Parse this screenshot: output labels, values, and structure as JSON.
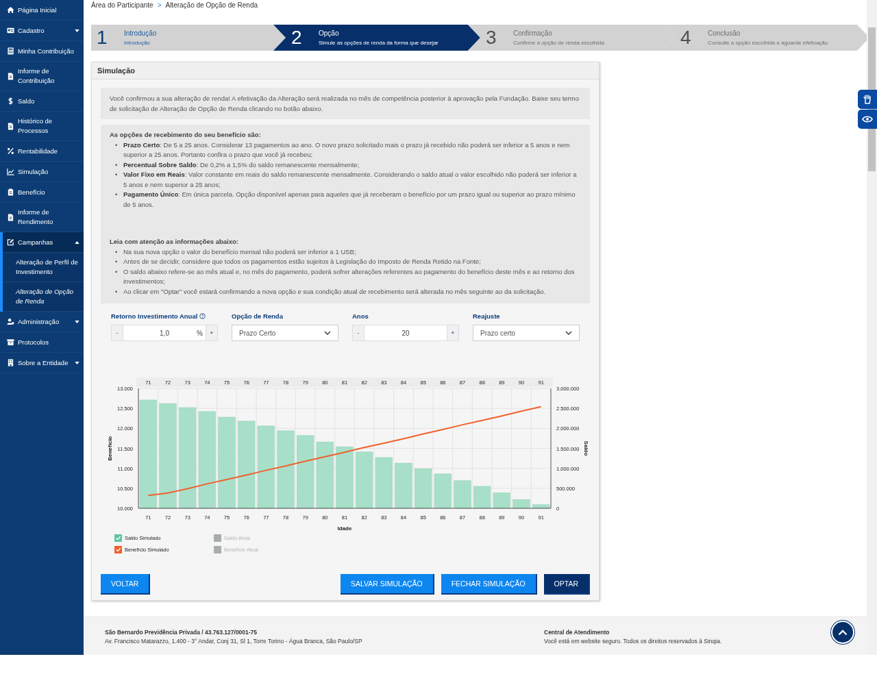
{
  "sidebar": {
    "items": [
      {
        "label": "Página Inicial"
      },
      {
        "label": "Cadastro",
        "expanded": false
      },
      {
        "label": "Minha Contribuição"
      },
      {
        "label": "Informe de Contribuição"
      },
      {
        "label": "Saldo"
      },
      {
        "label": "Histórico de Processos"
      },
      {
        "label": "Rentabilidade"
      },
      {
        "label": "Simulação"
      },
      {
        "label": "Benefício"
      },
      {
        "label": "Informe de Rendimento"
      },
      {
        "label": "Campanhas",
        "expanded": true,
        "children": [
          {
            "label": "Alteração de Perfil de Investimento",
            "selected": false
          },
          {
            "label": "Alteração de Opção de Renda",
            "selected": true
          }
        ]
      },
      {
        "label": "Administração",
        "expanded": false
      },
      {
        "label": "Protocolos"
      },
      {
        "label": "Sobre a Entidade",
        "expanded": false
      }
    ]
  },
  "breadcrumb": [
    "Área do Participante",
    "Alteração de Opção de Renda"
  ],
  "breadcrumb_separator": ">",
  "steps": [
    {
      "number": "1",
      "title": "Introdução",
      "subtitle": "Introdução",
      "selected": false
    },
    {
      "number": "2",
      "title": "Opção",
      "subtitle": "Simule as opções de renda da forma que desejar",
      "selected": true
    },
    {
      "number": "3",
      "title": "Confirmação",
      "subtitle": "Confirme a opção de renda escolhida",
      "selected": false
    },
    {
      "number": "4",
      "title": "Conclusão",
      "subtitle": "Consulte a opção escolhida e aguarde efetivação",
      "selected": false
    }
  ],
  "panel": {
    "title": "Simulação",
    "notice": "Você confirmou a sua alteração de renda! A efetivação da Alteração será realizada no mês de competência posterior à aprovação pela Fundação. Baixe seu termo de solicitação de Alteração de Opção de Renda clicando no botão abaixo.",
    "info_sections": [
      {
        "heading": "As opções de recebimento do seu benefício são:",
        "items": [
          {
            "bullet": "•",
            "text": "**Prazo Certo**: De 5 a 25 anos. Considerar 13 pagamentos ao ano. O novo prazo solicitado mais o prazo já recebido não poderá ser inferior a 5 anos e nem superior a 25 anos. Portanto confira o prazo que você já recebeu;"
          },
          {
            "bullet": "•",
            "text": "**Percentual Sobre Saldo**: De 0,2% a 1,5% do saldo remanescente mensalmente;"
          },
          {
            "bullet": "•",
            "text": "**Valor Fixo em Reais**: Valor constante em reais do saldo remanescente mensalmente. Considerando o saldo atual o valor escolhido não poderá ser inferior a 5 anos e nem superior a 25 anos;"
          },
          {
            "bullet": "•",
            "text": "**Pagamento Único**: Em única parcela. Opção disponível apenas para aqueles que já receberam o benefício por um prazo igual ou superior ao prazo mínimo de 5 anos."
          }
        ]
      },
      {
        "heading": "Leia com atenção as informações abaixo:",
        "items": [
          {
            "bullet": "•",
            "text": "Na sua nova opção o valor do benefício mensal não poderá ser inferior a 1 USB;"
          },
          {
            "bullet": "•",
            "text": "Antes de se decidir, considere que todos os pagamentos estão sujeitos à Legislação do Imposto de Renda Retido na Fonte;"
          },
          {
            "bullet": "•",
            "text": "O saldo abaixo refere-se ao mês atual e, no mês do pagamento, poderá sofrer alterações referentes ao pagamento do benefício deste mês e ao retorno dos investimentos;"
          },
          {
            "bullet": "•",
            "text": "Ao clicar em \"Optar\" você estará confirmando a nova opção e sua condição atual de recebimento será alterada no mês seguinte ao da solicitação."
          }
        ]
      }
    ],
    "fields": [
      {
        "kind": "stepper",
        "label": "Retorno Investimento Anual",
        "minus": "-",
        "value": "1,0",
        "unit": "%",
        "plus": "+"
      },
      {
        "kind": "select",
        "label": "Opção de Renda",
        "value": "Prazo Certo"
      },
      {
        "kind": "stepper",
        "label": "Anos",
        "minus": "-",
        "value": "20",
        "plus": "+"
      },
      {
        "kind": "select",
        "label": "Reajuste",
        "value": "Prazo certo"
      }
    ],
    "chart_data": {
      "type": "bar",
      "grid": true,
      "xlabel": "Idade",
      "ylabel": "Benefício",
      "y2label": "Saldo",
      "categories": [
        "71",
        "72",
        "73",
        "74",
        "75",
        "76",
        "77",
        "78",
        "79",
        "80",
        "81",
        "82",
        "83",
        "84",
        "85",
        "86",
        "87",
        "88",
        "89",
        "90",
        "91"
      ],
      "ylim": [
        10000,
        13000
      ],
      "yticks": [
        {
          "value": 10000,
          "label": "10.000"
        },
        {
          "value": 10500,
          "label": "10.500"
        },
        {
          "value": 11000,
          "label": "11.000"
        },
        {
          "value": 11500,
          "label": "11.500"
        },
        {
          "value": 12000,
          "label": "12.000"
        },
        {
          "value": 12500,
          "label": "12.500"
        },
        {
          "value": 13000,
          "label": "13.000"
        }
      ],
      "y2lim": [
        0,
        3000000
      ],
      "y2ticks": [
        {
          "value": 0,
          "label": "0"
        },
        {
          "value": 500000,
          "label": "500.000"
        },
        {
          "value": 1000000,
          "label": "1.000.000"
        },
        {
          "value": 1500000,
          "label": "1.500.000"
        },
        {
          "value": 2000000,
          "label": "2.000.000"
        },
        {
          "value": 2500000,
          "label": "2.500.000"
        },
        {
          "value": 3000000,
          "label": "3.000.000"
        }
      ],
      "series": [
        {
          "name": "Saldo Simulado",
          "axis": "y2",
          "color": "#a8dfc9",
          "values": [
            2710000,
            2620000,
            2520000,
            2420000,
            2280000,
            2180000,
            2060000,
            1940000,
            1820000,
            1660000,
            1540000,
            1410000,
            1270000,
            1130000,
            990000,
            860000,
            690000,
            550000,
            390000,
            220000,
            90000
          ]
        },
        {
          "name": "Benefício Simulado",
          "type": "line",
          "color": "#f0612d",
          "values": [
            10320,
            10380,
            10490,
            10610,
            10720,
            10830,
            10950,
            11060,
            11180,
            11290,
            11400,
            11520,
            11630,
            11740,
            11860,
            11970,
            12090,
            12200,
            12310,
            12430,
            12540
          ]
        },
        {
          "name": "Saldo Atual",
          "values": [
            null,
            null,
            null,
            null,
            null,
            null,
            null,
            null,
            null,
            null,
            null,
            null,
            null,
            null,
            null,
            null,
            null,
            null,
            null,
            null,
            null
          ]
        },
        {
          "name": "Benefício Atual",
          "type": "line",
          "values": [
            null,
            null,
            null,
            null,
            null,
            null,
            null,
            null,
            null,
            null,
            null,
            null,
            null,
            null,
            null,
            null,
            null,
            null,
            null,
            null,
            null
          ]
        }
      ]
    },
    "legend": [
      {
        "checked": true,
        "color": "#5cc6a0"
      },
      {
        "checked": true,
        "color": "#f0612d"
      },
      {
        "checked": false,
        "color": "#a7aeaa"
      },
      {
        "checked": false,
        "color": "#a7aeaa"
      }
    ],
    "buttons": [
      {
        "label": "VOLTAR",
        "kind": "primary"
      },
      {
        "label": "SALVAR SIMULAÇÃO",
        "kind": "primary"
      },
      {
        "label": "FECHAR SIMULAÇÃO",
        "kind": "primary"
      },
      {
        "label": "OPTAR",
        "kind": "dark"
      }
    ]
  },
  "footer": [
    {
      "title": "São Bernardo Previdência Privada / 43.763.127/0001-75",
      "text": "Av. Francisco Matarazzo, 1.400 - 3° Andar, Conj 31, Sl 1, Torre Torino - Água Branca, São Paulo/SP"
    },
    {
      "title": "Central de Atendimento",
      "text": "Você está em website seguro. Todos os direitos reservados à Sinqia."
    }
  ]
}
